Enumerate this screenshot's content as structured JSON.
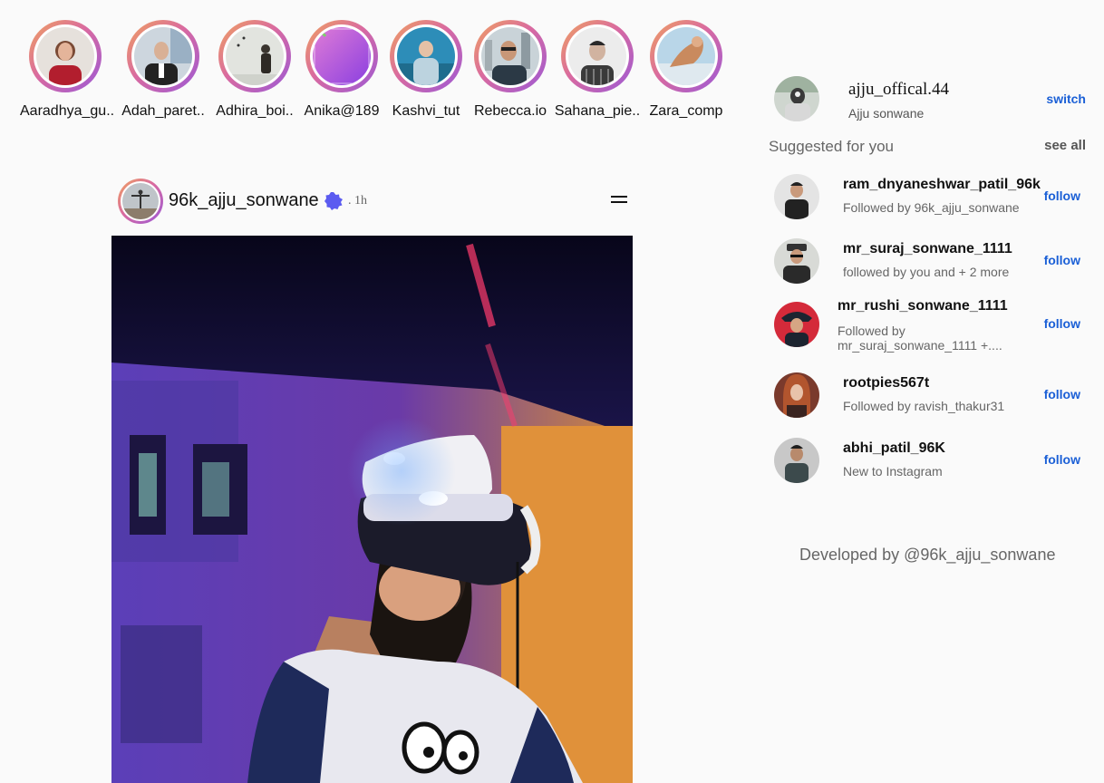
{
  "stories": [
    {
      "name": "Aaradhya_gu.."
    },
    {
      "name": "Adah_paret.."
    },
    {
      "name": "Adhira_boi.."
    },
    {
      "name": "Anika@189"
    },
    {
      "name": "Kashvi_tut"
    },
    {
      "name": "Rebecca.io"
    },
    {
      "name": "Sahana_pie.."
    },
    {
      "name": "Zara_comp"
    }
  ],
  "post": {
    "username": "96k_ajju_sonwane",
    "time": ". 1h",
    "verified_color": "#5b5bf0",
    "menu_icon": "hamburger-icon"
  },
  "sidebar": {
    "me": {
      "username": "ajju_offical.44",
      "full_name": "Ajju sonwane",
      "switch_label": "switch"
    },
    "suggested_title": "Suggested for you",
    "see_all_label": "see all",
    "suggestions": [
      {
        "username": "ram_dnyaneshwar_patil_96k",
        "sub": "Followed by 96k_ajju_sonwane",
        "action": "follow"
      },
      {
        "username": "mr_suraj_sonwane_1111",
        "sub": "followed by you and + 2 more",
        "action": "follow"
      },
      {
        "username": "mr_rushi_sonwane_1111",
        "sub": "Followed by mr_suraj_sonwane_1111 +....",
        "action": "follow"
      },
      {
        "username": "rootpies567t",
        "sub": "Followed by ravish_thakur31",
        "action": "follow"
      },
      {
        "username": "abhi_patil_96K",
        "sub": "New to Instagram",
        "action": "follow"
      }
    ],
    "footer": "Developed by @96k_ajju_sonwane"
  },
  "colors": {
    "link": "#1a5fd6",
    "ring_start": "#f0a35e",
    "ring_end": "#9b59d6"
  }
}
